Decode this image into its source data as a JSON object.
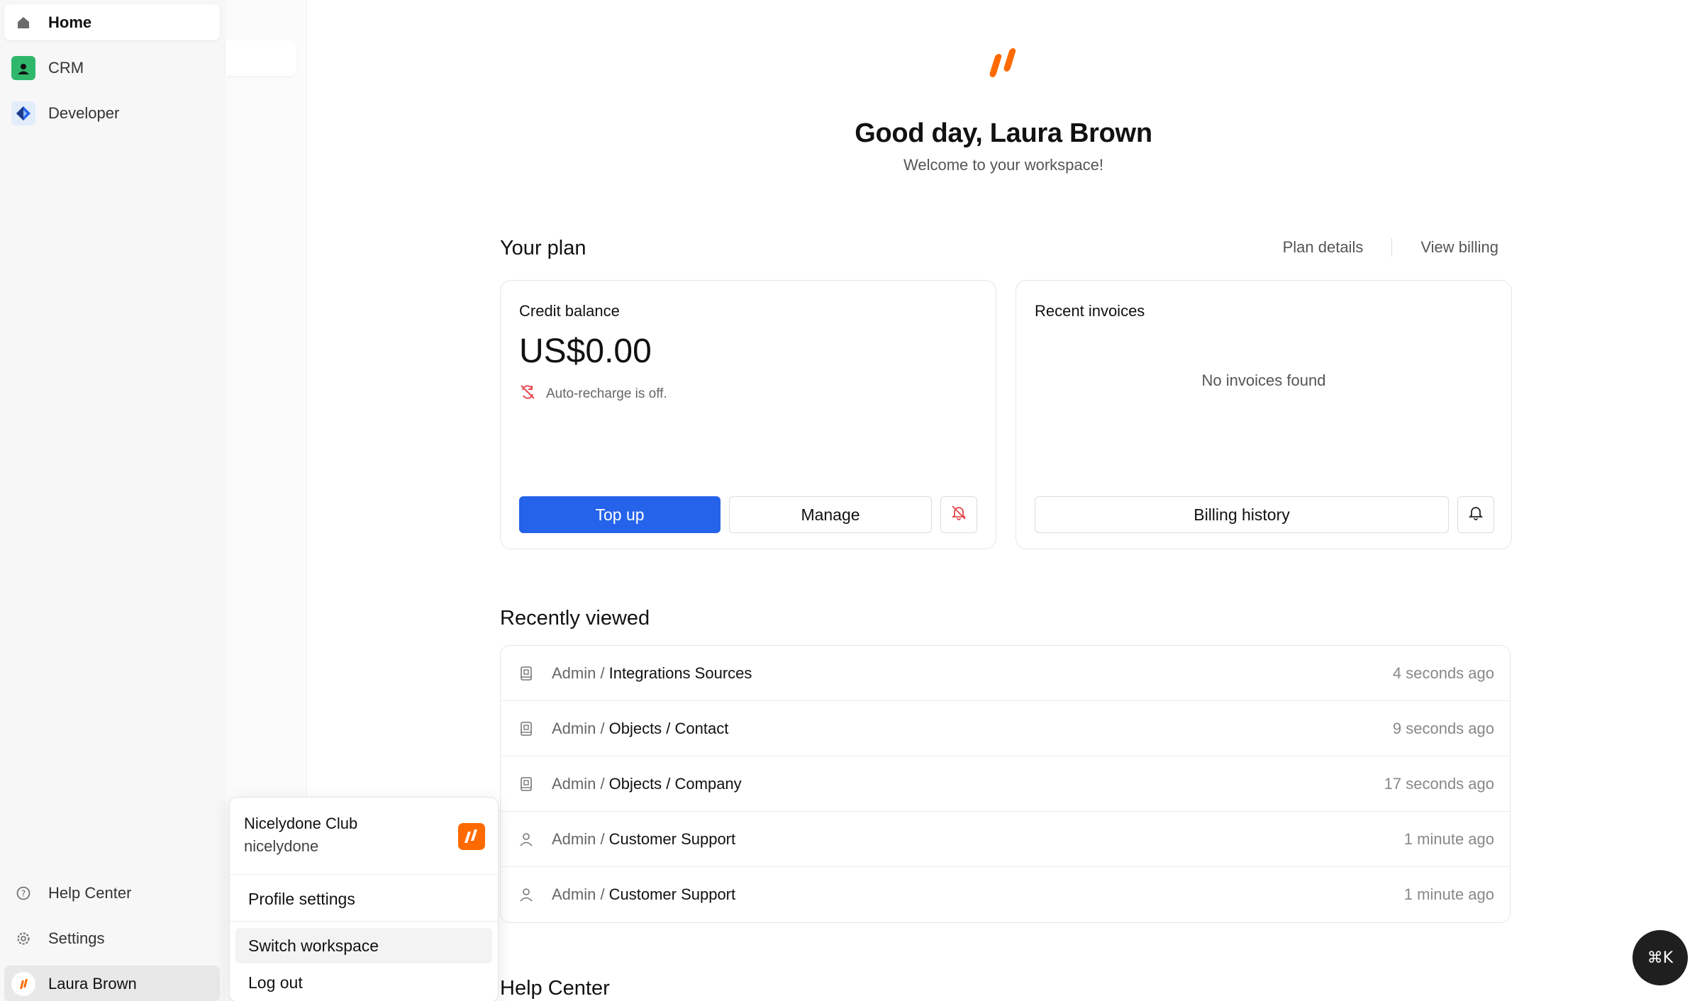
{
  "sidebar": {
    "items": [
      {
        "label": "Home",
        "icon": "home-icon"
      },
      {
        "label": "CRM",
        "icon": "crm-icon"
      },
      {
        "label": "Developer",
        "icon": "developer-icon"
      }
    ],
    "bottom": [
      {
        "label": "Help Center",
        "icon": "help-circle-icon"
      },
      {
        "label": "Settings",
        "icon": "gear-icon"
      },
      {
        "label": "Laura Brown",
        "icon": "workspace-logo-icon"
      }
    ]
  },
  "main": {
    "greeting": "Good day, Laura Brown",
    "subtitle": "Welcome to your workspace!",
    "plan": {
      "title": "Your plan",
      "links": [
        "Plan details",
        "View billing"
      ],
      "credit": {
        "title": "Credit balance",
        "amount": "US$0.00",
        "auto_recharge": "Auto-recharge is off.",
        "buttons": {
          "top_up": "Top up",
          "manage": "Manage"
        }
      },
      "invoices": {
        "title": "Recent invoices",
        "empty": "No invoices found",
        "button": "Billing history"
      }
    },
    "recently_viewed": {
      "title": "Recently viewed",
      "rows": [
        {
          "crumb": "Admin /",
          "name": "Integrations Sources",
          "time": "4 seconds ago",
          "icon": "book-icon"
        },
        {
          "crumb": "Admin /",
          "name": "Objects / Contact",
          "time": "9 seconds ago",
          "icon": "book-icon"
        },
        {
          "crumb": "Admin /",
          "name": "Objects / Company",
          "time": "17 seconds ago",
          "icon": "book-icon"
        },
        {
          "crumb": "Admin /",
          "name": "Customer Support",
          "time": "1 minute ago",
          "icon": "user-icon"
        },
        {
          "crumb": "Admin /",
          "name": "Customer Support",
          "time": "1 minute ago",
          "icon": "user-icon"
        }
      ]
    },
    "help_center_title": "Help Center"
  },
  "popup": {
    "workspace_name": "Nicelydone Club",
    "workspace_slug": "nicelydone",
    "items": [
      "Profile settings",
      "Switch workspace",
      "Log out"
    ]
  },
  "cmdk_label": "⌘K",
  "colors": {
    "accent": "#2563eb",
    "brand": "#ff6a00",
    "danger": "#e5484d"
  }
}
